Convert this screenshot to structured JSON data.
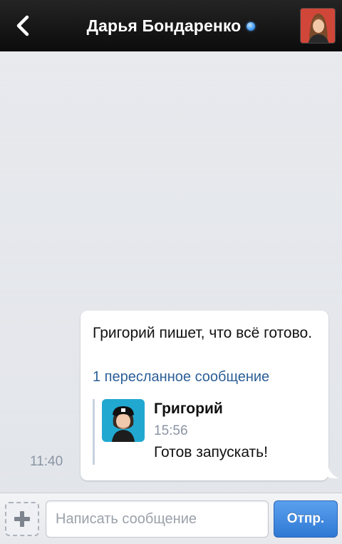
{
  "header": {
    "title": "Дарья Бондаренко",
    "online": true,
    "back_icon": "chevron-left-icon"
  },
  "message": {
    "time": "11:40",
    "text": "Григорий пишет, что всё готово.",
    "forwarded_link": "1 пересланное сообщение",
    "forwarded": {
      "author": "Григорий",
      "time": "15:56",
      "text": "Готов запускать!"
    }
  },
  "composer": {
    "placeholder": "Написать сообщение",
    "value": "",
    "send_label": "Отпр.",
    "attach_icon": "plus-icon"
  },
  "colors": {
    "topbar": "#121212",
    "chat_bg": "#e4e7ec",
    "link": "#2b5f96",
    "online_dot": "#3d9af0",
    "send_button": "#3a83db"
  }
}
